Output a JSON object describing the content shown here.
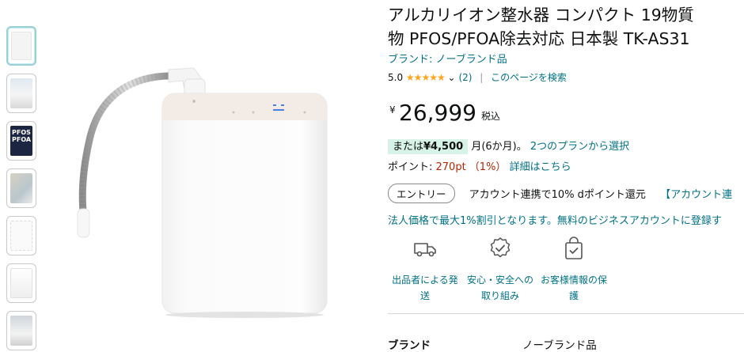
{
  "thumbnails": [
    {
      "name": "thumb-1",
      "text": ""
    },
    {
      "name": "thumb-2",
      "text": ""
    },
    {
      "name": "thumb-3",
      "text": "PFOS PFOA"
    },
    {
      "name": "thumb-4",
      "text": ""
    },
    {
      "name": "thumb-5",
      "text": ""
    },
    {
      "name": "thumb-6",
      "text": ""
    },
    {
      "name": "thumb-7",
      "text": ""
    }
  ],
  "product": {
    "title_line1": "アルカリイオン整水器 コンパクト 19物質",
    "title_line2": "物 PFOS/PFOA除去対応 日本製 TK-AS31",
    "brand_link": "ブランド: ノーブランド品",
    "rating_value": "5.0",
    "rating_stars": "★★★★★",
    "review_count": "(2)",
    "search_link": "このページを検索",
    "price_symbol": "¥",
    "price": "26,999",
    "tax_label": "税込",
    "installment_prefix": "または",
    "installment_amount": "¥4,500",
    "installment_suffix": "月(6か月)。",
    "installment_link": "2つのプランから選択",
    "points_label": "ポイント: ",
    "points_value": "270pt （1%）",
    "points_link": "詳細はこちら",
    "entry_button": "エントリー",
    "entry_text": "アカウント連携で10% dポイント還元",
    "entry_link": "【アカウント連",
    "business_text": "法人価格で最大1%割引となります。無料のビジネスアカウントに登録す"
  },
  "features": [
    {
      "icon": "truck-icon",
      "label": "出品者による発送"
    },
    {
      "icon": "shield-check-icon",
      "label": "安心・安全への取り組み"
    },
    {
      "icon": "bag-check-icon",
      "label": "お客様情報の保護"
    }
  ],
  "specs": [
    {
      "label": "ブランド",
      "value": "ノーブランド品"
    }
  ],
  "colors": {
    "link": "#007185",
    "price_red": "#b12704",
    "star": "#ffa41c",
    "install_bg": "#d7f3e8"
  }
}
